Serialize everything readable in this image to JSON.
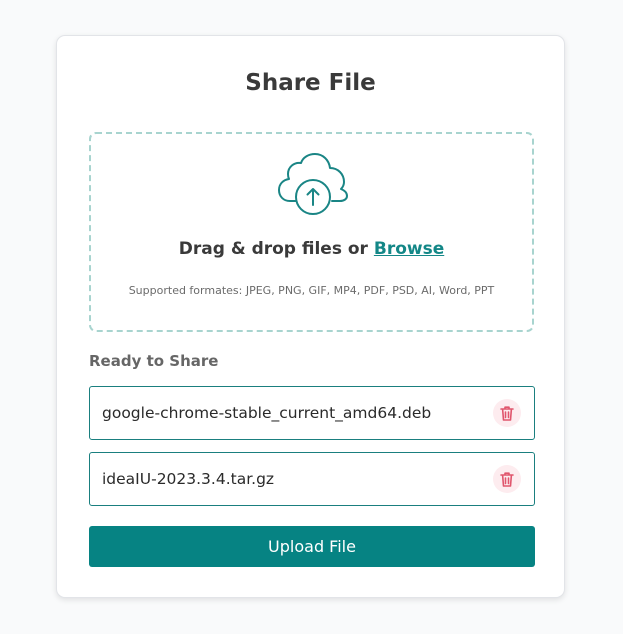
{
  "card": {
    "title": "Share File"
  },
  "dropzone": {
    "icon": "cloud-upload-icon",
    "drag_text": "Drag & drop files or ",
    "browse_label": "Browse",
    "formats_text": "Supported formates: JPEG, PNG, GIF, MP4, PDF, PSD, AI, Word, PPT"
  },
  "ready": {
    "label": "Ready to Share",
    "files": [
      {
        "name": "google-chrome-stable_current_amd64.deb",
        "icon": "trash-icon"
      },
      {
        "name": "ideaIU-2023.3.4.tar.gz",
        "icon": "trash-icon"
      }
    ]
  },
  "actions": {
    "upload_label": "Upload File"
  },
  "colors": {
    "accent": "#068383",
    "link": "#138787",
    "dropzone_border": "#a8d4cf",
    "delete_icon": "#e0566d",
    "delete_bg": "#fdecef"
  }
}
